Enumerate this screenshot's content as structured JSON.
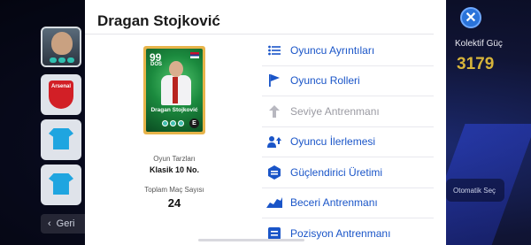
{
  "background": {
    "back_label": "Geri",
    "kolektif_label": "Kolektif Güç",
    "kolektif_value": "3179",
    "auto_label": "Otomatik Seç",
    "team_crest_text": "Arsenal"
  },
  "modal": {
    "title": "Dragan Stojković",
    "card": {
      "rating": "99",
      "position": "DOS",
      "name": "Dragan Stojković"
    },
    "play_style": {
      "label": "Oyun Tarzları",
      "value": "Klasik 10 No."
    },
    "matches": {
      "label": "Toplam Maç Sayısı",
      "value": "24"
    },
    "menu": [
      {
        "label": "Oyuncu Ayrıntıları",
        "icon": "list-icon",
        "enabled": true
      },
      {
        "label": "Oyuncu Rolleri",
        "icon": "flag-icon",
        "enabled": true
      },
      {
        "label": "Seviye Antrenmanı",
        "icon": "level-up-icon",
        "enabled": false
      },
      {
        "label": "Oyuncu İlerlemesi",
        "icon": "player-progress-icon",
        "enabled": true
      },
      {
        "label": "Güçlendirici Üretimi",
        "icon": "booster-icon",
        "enabled": true
      },
      {
        "label": "Beceri Antrenmanı",
        "icon": "skill-training-icon",
        "enabled": true
      },
      {
        "label": "Pozisyon Antrenmanı",
        "icon": "position-training-icon",
        "enabled": true
      }
    ]
  },
  "colors": {
    "accent": "#1a55c8",
    "disabled": "#9a9aa2",
    "gold": "#d7b43a"
  }
}
